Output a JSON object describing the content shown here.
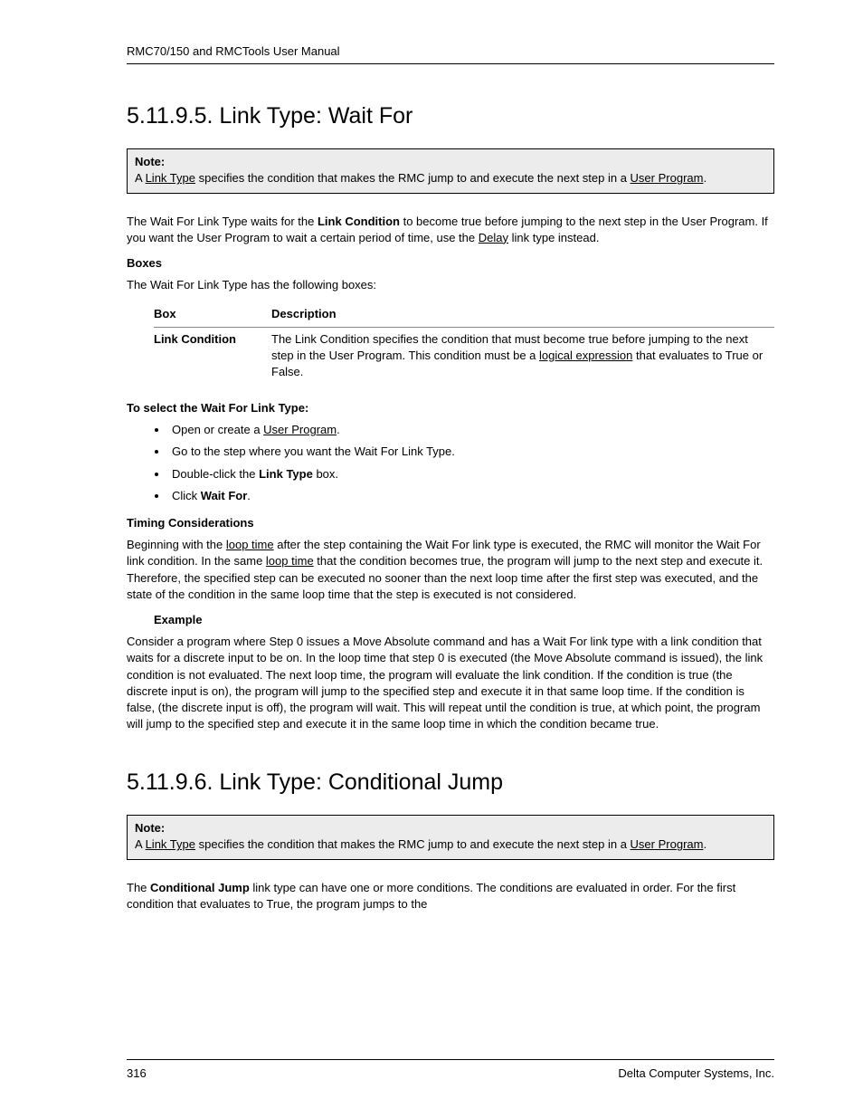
{
  "header": {
    "running": "RMC70/150 and RMCTools User Manual"
  },
  "section1": {
    "number": "5.11.9.5.",
    "title": "Link Type: Wait For",
    "note": {
      "label": "Note:",
      "pre": "A ",
      "linkType": "Link Type",
      "mid": " specifies the condition that makes the RMC jump to and execute the next step in a ",
      "userProgram": "User Program",
      "end": "."
    },
    "intro": {
      "p1a": "The Wait For Link Type waits for the ",
      "p1b_bold": "Link Condition",
      "p1c": " to become true before jumping to the next step in the User Program. If you want the User Program to wait a certain period of time, use the ",
      "p1d_link": "Delay",
      "p1e": " link type instead."
    },
    "boxes": {
      "heading": "Boxes",
      "lead": "The Wait For Link Type has the following boxes:",
      "col1": "Box",
      "col2": "Description",
      "row1": {
        "name": "Link Condition",
        "desc_a": "The Link Condition specifies the condition that must become true before jumping to the next step in the User Program. This condition must be a ",
        "desc_link": "logical expression",
        "desc_b": " that evaluates to True or False."
      }
    },
    "select": {
      "heading": "To select the Wait For Link Type:",
      "li1a": "Open or create a ",
      "li1b": "User Program",
      "li1c": ".",
      "li2": "Go to the step where you want the Wait For Link Type.",
      "li3a": "Double-click the ",
      "li3b": "Link Type",
      "li3c": " box.",
      "li4a": "Click ",
      "li4b": "Wait For",
      "li4c": "."
    },
    "timing": {
      "heading": "Timing Considerations",
      "p1a": "Beginning with the ",
      "p1b": "loop time",
      "p1c": " after the step containing the Wait For link type is executed, the RMC will monitor the Wait For link condition. In the same ",
      "p1d": "loop time",
      "p1e": " that the condition becomes true, the program will jump to the next step and execute it. Therefore, the specified step can be executed no sooner than the next loop time after the first step was executed, and the state of the condition in the same loop time that the step is executed is not considered.",
      "exampleHead": "Example",
      "example": "Consider a program where Step 0 issues a Move Absolute command and has a Wait For link type with a link condition that waits for a discrete input to be on. In the loop time that step 0 is executed (the Move Absolute command is issued), the link condition is not evaluated. The next loop time, the program will evaluate the link condition. If the condition is true (the discrete input is on), the program will jump to the specified step and execute it in that same loop time. If the condition is false, (the discrete input is off), the program will wait. This will repeat until the condition is true, at which point, the program will jump to the specified step and execute it in the same loop time in which the condition became true."
    }
  },
  "section2": {
    "number": "5.11.9.6.",
    "title": "Link Type: Conditional Jump",
    "note": {
      "label": "Note:",
      "pre": "A ",
      "linkType": "Link Type",
      "mid": " specifies the condition that makes the RMC jump to and execute the next step in a ",
      "userProgram": "User Program",
      "end": "."
    },
    "intro": {
      "p1a": "The ",
      "p1b_bold": "Conditional Jump",
      "p1c": " link type can have one or more conditions. The conditions are evaluated in order. For the first condition that evaluates to True, the program jumps to the"
    }
  },
  "footer": {
    "page": "316",
    "company": "Delta Computer Systems, Inc."
  }
}
